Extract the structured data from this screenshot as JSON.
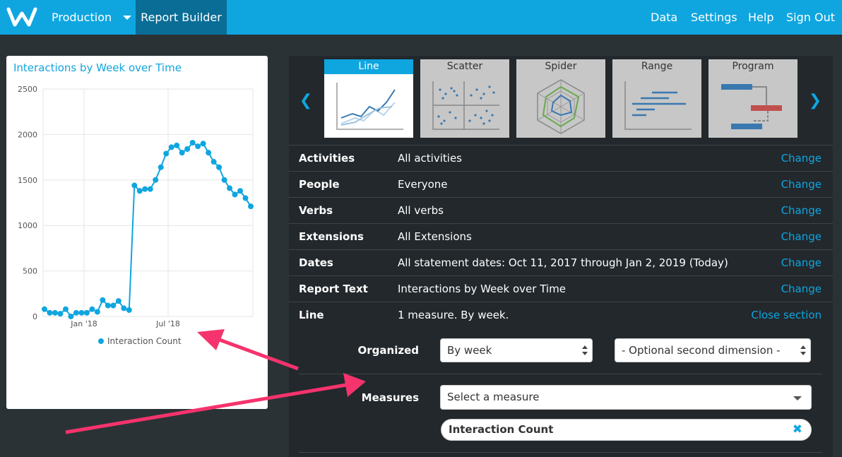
{
  "nav": {
    "environment": "Production",
    "active_tab": "Report Builder",
    "links": [
      "Data",
      "Settings",
      "Help",
      "Sign Out"
    ]
  },
  "chart_card": {
    "title": "Interactions by Week over Time"
  },
  "chart_data": {
    "type": "line",
    "title": "Interactions by Week over Time",
    "ylim": [
      0,
      2500
    ],
    "yticks": [
      0,
      500,
      1000,
      1500,
      2000,
      2500
    ],
    "xtick_labels": [
      "Jan '18",
      "Jul '18"
    ],
    "series": [
      {
        "name": "Interaction Count",
        "color": "#0fa6e0",
        "values": [
          80,
          40,
          40,
          30,
          80,
          0,
          40,
          40,
          40,
          80,
          50,
          180,
          120,
          120,
          170,
          90,
          70,
          1440,
          1380,
          1400,
          1400,
          1500,
          1640,
          1790,
          1860,
          1880,
          1800,
          1840,
          1910,
          1870,
          1900,
          1800,
          1700,
          1640,
          1500,
          1410,
          1340,
          1380,
          1300,
          1210
        ]
      }
    ],
    "legend": "bottom"
  },
  "chart_types": [
    "Line",
    "Scatter",
    "Spider",
    "Range",
    "Program"
  ],
  "active_chart_type": "Line",
  "filters": [
    {
      "label": "Activities",
      "value": "All activities",
      "action": "Change"
    },
    {
      "label": "People",
      "value": "Everyone",
      "action": "Change"
    },
    {
      "label": "Verbs",
      "value": "All verbs",
      "action": "Change"
    },
    {
      "label": "Extensions",
      "value": "All Extensions",
      "action": "Change"
    },
    {
      "label": "Dates",
      "value": "All statement dates: Oct 11, 2017 through Jan 2, 2019 (Today)",
      "action": "Change"
    },
    {
      "label": "Report Text",
      "value": "Interactions by Week over Time",
      "action": "Change"
    },
    {
      "label": "Line",
      "value": "1 measure. By week.",
      "action": "Close section"
    }
  ],
  "line_section": {
    "organized_label": "Organized",
    "organized_value": "By week",
    "second_dimension": "- Optional second dimension -",
    "measures_label": "Measures",
    "measure_placeholder": "Select a measure",
    "selected_measure": "Interaction Count"
  },
  "colors": {
    "brand": "#0fa6e0",
    "nav_active": "#0a6d96",
    "background": "#2b3236",
    "panel": "#22282c",
    "annotation_arrow": "#f5336d"
  }
}
